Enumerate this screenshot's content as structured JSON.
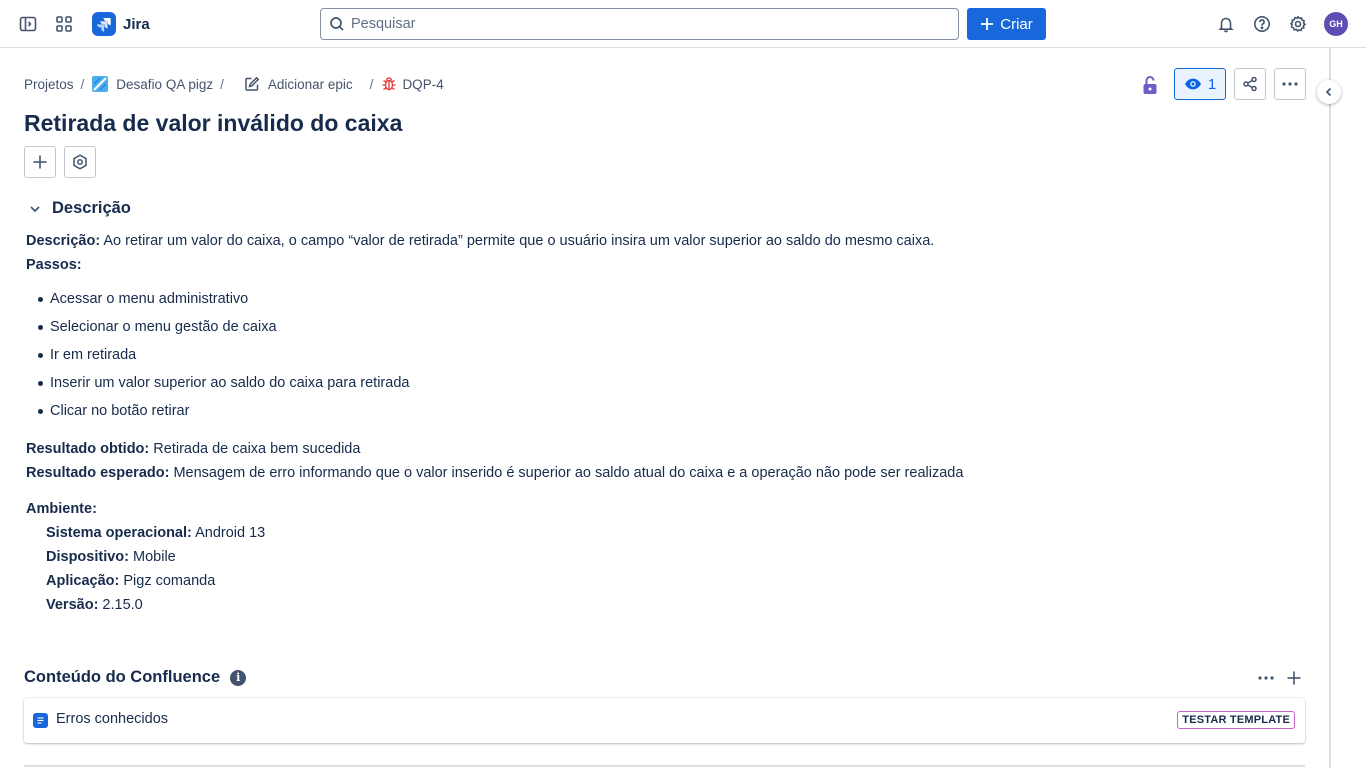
{
  "topbar": {
    "app_name": "Jira",
    "search_placeholder": "Pesquisar",
    "create_label": "Criar",
    "avatar_initials": "GH"
  },
  "breadcrumb": {
    "projects": "Projetos",
    "project": "Desafio QA pigz",
    "add_epic": "Adicionar epic",
    "issue_key": "DQP-4"
  },
  "header": {
    "watch_count": "1"
  },
  "issue": {
    "title": "Retirada de valor inválido do caixa"
  },
  "description": {
    "section_title": "Descrição",
    "desc_label": "Descrição:",
    "desc_text": " Ao retirar um valor do caixa, o campo “valor de retirada” permite que o usuário insira um valor superior ao saldo do mesmo caixa.",
    "steps_label": "Passos:",
    "steps": [
      "Acessar o menu administrativo",
      "Selecionar o menu gestão de caixa",
      "Ir em retirada",
      "Inserir um valor superior ao saldo do caixa para retirada",
      "Clicar no botão retirar"
    ],
    "obtained_label": "Resultado obtido:",
    "obtained_text": " Retirada de caixa bem sucedida",
    "expected_label": "Resultado esperado:",
    "expected_text": " Mensagem de erro informando que o valor inserido é superior ao saldo atual do caixa e a operação não pode ser realizada",
    "env_label": "Ambiente:",
    "env": {
      "os_label": "Sistema operacional:",
      "os_value": " Android 13",
      "device_label": "Dispositivo:",
      "device_value": " Mobile",
      "app_label": "Aplicação:",
      "app_value": " Pigz comanda",
      "version_label": "Versão:",
      "version_value": " 2.15.0"
    }
  },
  "confluence": {
    "section_title": "Conteúdo do Confluence",
    "item_title": "Erros conhecidos",
    "item_tag": "TESTAR TEMPLATE"
  },
  "colors": {
    "brand_blue": "#1868db",
    "lock_purple": "#6e5dc6",
    "bug_red": "#e2483d",
    "avatar": "#5e4db2",
    "tag_border": "#c663c6"
  }
}
